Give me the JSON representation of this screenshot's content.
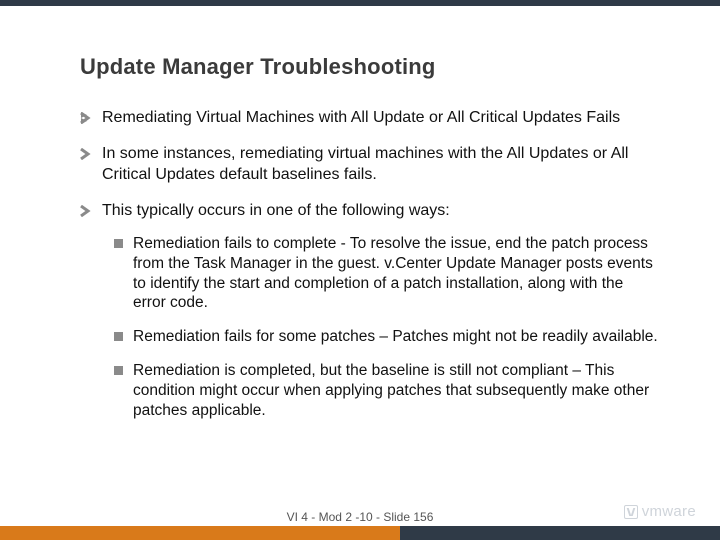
{
  "title": "Update Manager Troubleshooting",
  "bullets": {
    "b0": "Remediating Virtual Machines with All Update or All Critical Updates Fails",
    "b1": "In some instances, remediating virtual machines with the All Updates or All Critical Updates default baselines fails.",
    "b2": "This typically occurs in one of the following ways:"
  },
  "subbullets": {
    "s0": "Remediation fails to complete - To resolve the issue, end the patch process from the Task Manager in the guest. v.Center Update Manager posts events to identify the start and completion of a patch installation, along with the error code.",
    "s1": "Remediation fails for some patches – Patches might not be readily available.",
    "s2": "Remediation is completed, but the baseline is still not compliant – This condition might occur when applying patches that subsequently make other patches applicable."
  },
  "footer": {
    "text": "VI 4 - Mod 2 -10 - Slide 156",
    "logo": "vmware"
  },
  "colors": {
    "orange": "#d97a1a",
    "dark": "#2f3a47"
  }
}
